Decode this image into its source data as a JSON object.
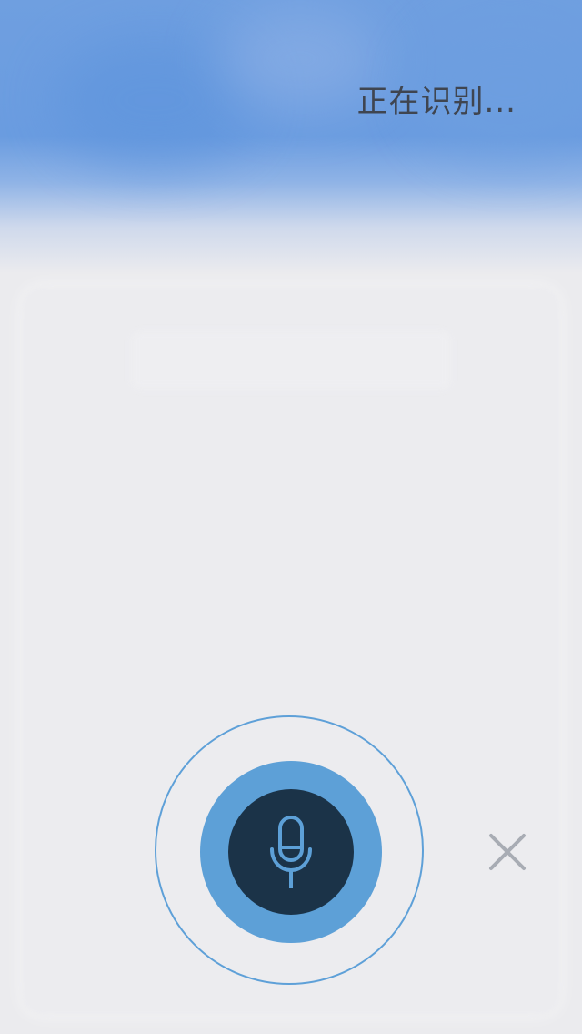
{
  "status": {
    "text": "正在识别..."
  },
  "voice": {
    "mic_icon": "microphone-icon",
    "close_icon": "close-icon",
    "accent_color": "#5da0d7",
    "core_color": "#1b3348"
  }
}
